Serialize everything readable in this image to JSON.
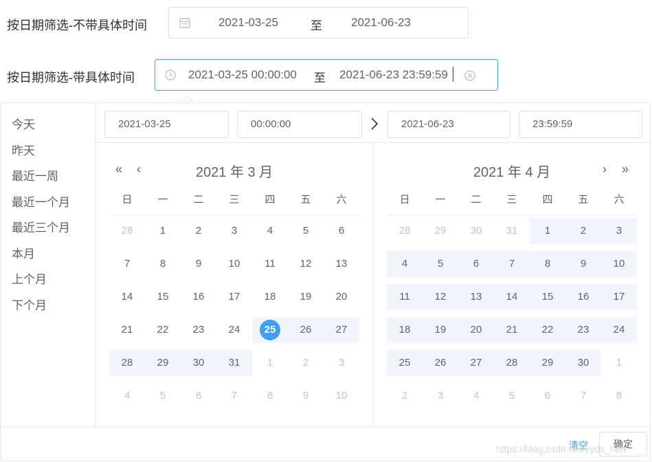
{
  "row1": {
    "label": "按日期筛选-不带具体时间",
    "start": "2021-03-25",
    "sep": "至",
    "end": "2021-06-23",
    "icon": "calendar-icon"
  },
  "row2": {
    "label": "按日期筛选-带具体时间",
    "start": "2021-03-25 00:00:00",
    "sep": "至",
    "end": "2021-06-23 23:59:59",
    "icon": "clock-icon",
    "clear_icon": "circle-close-icon"
  },
  "shortcuts": [
    "今天",
    "昨天",
    "最近一周",
    "最近一个月",
    "最近三个月",
    "本月",
    "上个月",
    "下个月"
  ],
  "inputs": {
    "start_date": "2021-03-25",
    "start_time": "00:00:00",
    "end_date": "2021-06-23",
    "end_time": "23:59:59"
  },
  "weekdays": [
    "日",
    "一",
    "二",
    "三",
    "四",
    "五",
    "六"
  ],
  "left_calendar": {
    "title": "2021 年 3 月",
    "days": [
      "28",
      "1",
      "2",
      "3",
      "4",
      "5",
      "6",
      "7",
      "8",
      "9",
      "10",
      "11",
      "12",
      "13",
      "14",
      "15",
      "16",
      "17",
      "18",
      "19",
      "20",
      "21",
      "22",
      "23",
      "24",
      "25",
      "26",
      "27",
      "28",
      "29",
      "30",
      "31",
      "1",
      "2",
      "3",
      "4",
      "5",
      "6",
      "7",
      "8",
      "9",
      "10"
    ]
  },
  "right_calendar": {
    "title": "2021 年 4 月",
    "days": [
      "28",
      "29",
      "30",
      "31",
      "1",
      "2",
      "3",
      "4",
      "5",
      "6",
      "7",
      "8",
      "9",
      "10",
      "11",
      "12",
      "13",
      "14",
      "15",
      "16",
      "17",
      "18",
      "19",
      "20",
      "21",
      "22",
      "23",
      "24",
      "25",
      "26",
      "27",
      "28",
      "29",
      "30",
      "1",
      "2",
      "3",
      "4",
      "5",
      "6",
      "7",
      "8"
    ]
  },
  "footer": {
    "clear": "清空",
    "confirm": "确定"
  },
  "watermark": "https://blog.csdn.net/yyds_hen",
  "colors": {
    "accent": "#409eff",
    "range_bg": "#f2f6fc",
    "dim": "#c0c4cc"
  }
}
